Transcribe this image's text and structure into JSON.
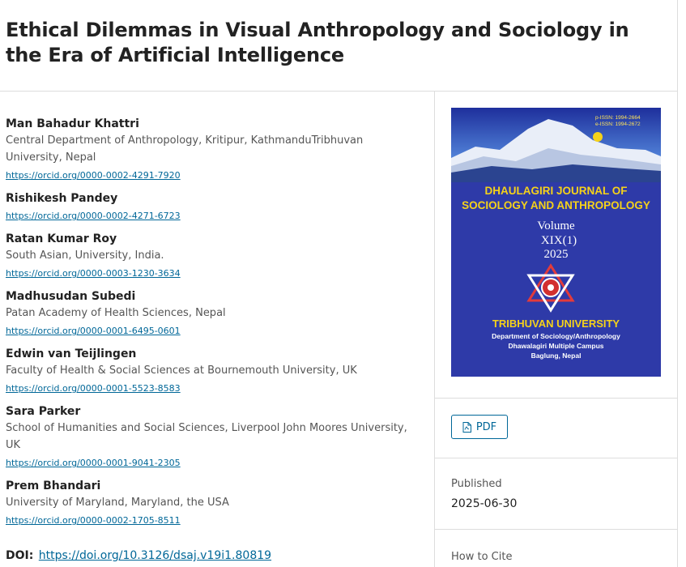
{
  "article": {
    "title": "Ethical Dilemmas in Visual Anthropology and Sociology in the Era of Artificial Intelligence",
    "doi_label": "DOI:",
    "doi": "https://doi.org/10.3126/dsaj.v19i1.80819"
  },
  "authors": [
    {
      "name": "Man Bahadur Khattri",
      "affiliation": "Central Department of Anthropology, Kritipur, KathmanduTribhuvan University, Nepal",
      "orcid": "https://orcid.org/0000-0002-4291-7920"
    },
    {
      "name": "Rishikesh Pandey",
      "affiliation": "",
      "orcid": "https://orcid.org/0000-0002-4271-6723"
    },
    {
      "name": "Ratan Kumar Roy",
      "affiliation": "South Asian, University, India.",
      "orcid": "https://orcid.org/0000-0003-1230-3634"
    },
    {
      "name": "Madhusudan Subedi",
      "affiliation": "Patan Academy of Health Sciences, Nepal",
      "orcid": "https://orcid.org/0000-0001-6495-0601"
    },
    {
      "name": "Edwin van Teijlingen",
      "affiliation": "Faculty of Health & Social Sciences at Bournemouth University, UK",
      "orcid": "https://orcid.org/0000-0001-5523-8583"
    },
    {
      "name": "Sara Parker",
      "affiliation": "School of Humanities and Social Sciences, Liverpool John Moores University, UK",
      "orcid": "https://orcid.org/0000-0001-9041-2305"
    },
    {
      "name": "Prem Bhandari",
      "affiliation": "University of Maryland, Maryland, the USA",
      "orcid": "https://orcid.org/0000-0002-1705-8511"
    }
  ],
  "cover": {
    "issn_print": "p-ISSN: 1994-2664",
    "issn_online": "e-ISSN: 1994-2672",
    "journal_line1": "DHAULAGIRI JOURNAL OF",
    "journal_line2": "SOCIOLOGY AND ANTHROPOLOGY",
    "volume_label": "Volume",
    "volume_number": "XIX(1)",
    "year": "2025",
    "university": "TRIBHUVAN UNIVERSITY",
    "department": "Department of Sociology/Anthropology",
    "campus": "Dhawalagiri Multiple Campus",
    "location": "Baglung, Nepal"
  },
  "sidebar": {
    "pdf_label": "PDF",
    "published_label": "Published",
    "published_date": "2025-06-30",
    "cite_label": "How to Cite"
  },
  "colors": {
    "link": "#006798",
    "cover_blue": "#2e3aa8",
    "cover_yellow": "#f5d21a"
  }
}
